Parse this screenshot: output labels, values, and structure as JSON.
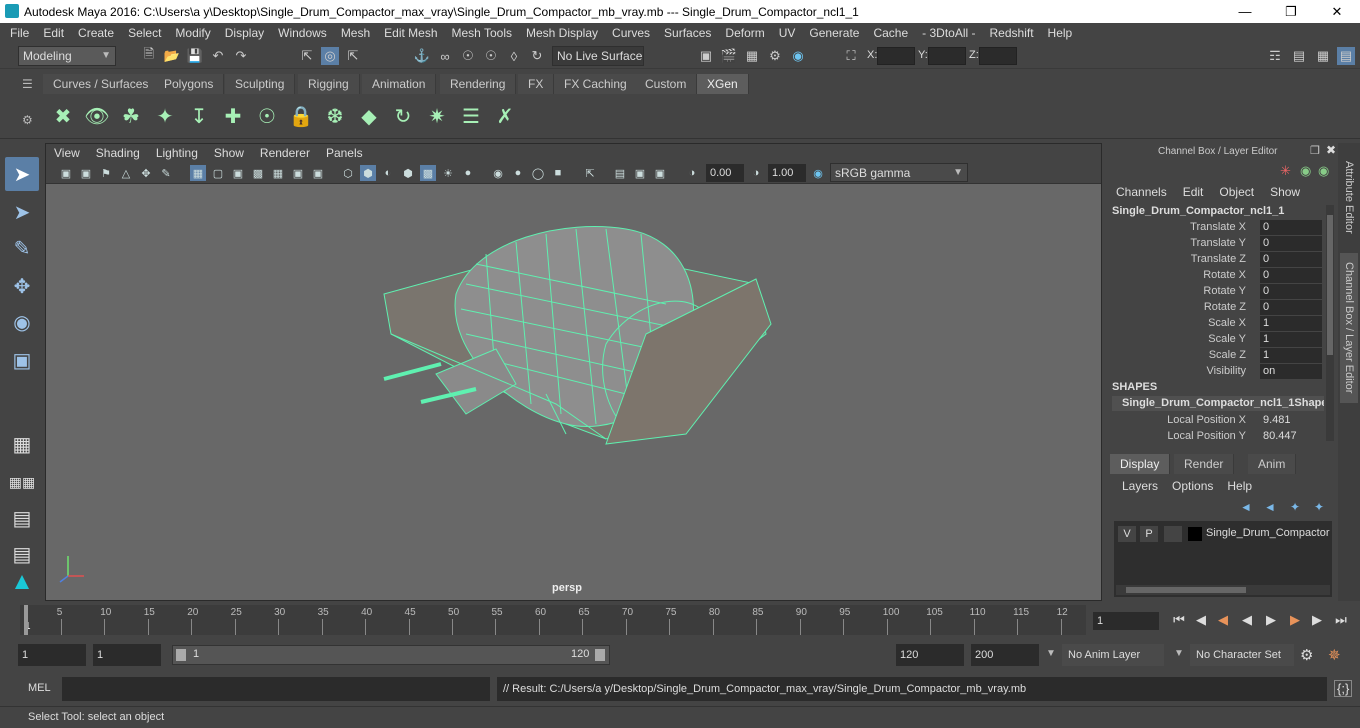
{
  "window": {
    "title": "Autodesk Maya 2016: C:\\Users\\a y\\Desktop\\Single_Drum_Compactor_max_vray\\Single_Drum_Compactor_mb_vray.mb   ---   Single_Drum_Compactor_ncl1_1"
  },
  "menu": [
    "File",
    "Edit",
    "Create",
    "Select",
    "Modify",
    "Display",
    "Windows",
    "Mesh",
    "Edit Mesh",
    "Mesh Tools",
    "Mesh Display",
    "Curves",
    "Surfaces",
    "Deform",
    "UV",
    "Generate",
    "Cache",
    "- 3DtoAll -",
    "Redshift",
    "Help"
  ],
  "status_line": {
    "mode": "Modeling",
    "live_surface": "No Live Surface",
    "x_label": "X:",
    "y_label": "Y:",
    "z_label": "Z:"
  },
  "shelf_tabs": [
    "Curves / Surfaces",
    "Polygons",
    "Sculpting",
    "Rigging",
    "Animation",
    "Rendering",
    "FX",
    "FX Caching",
    "Custom",
    "XGen"
  ],
  "active_shelf_tab": "XGen",
  "viewport": {
    "menu": [
      "View",
      "Shading",
      "Lighting",
      "Show",
      "Renderer",
      "Panels"
    ],
    "exposure": "0.00",
    "gamma": "1.00",
    "color_space": "sRGB gamma",
    "camera_label": "persp",
    "wire_color": "#5ff0b0"
  },
  "channel_box": {
    "title": "Channel Box / Layer Editor",
    "menu": [
      "Channels",
      "Edit",
      "Object",
      "Show"
    ],
    "object_name": "Single_Drum_Compactor_ncl1_1",
    "attributes": [
      {
        "label": "Translate X",
        "value": "0"
      },
      {
        "label": "Translate Y",
        "value": "0"
      },
      {
        "label": "Translate Z",
        "value": "0"
      },
      {
        "label": "Rotate X",
        "value": "0"
      },
      {
        "label": "Rotate Y",
        "value": "0"
      },
      {
        "label": "Rotate Z",
        "value": "0"
      },
      {
        "label": "Scale X",
        "value": "1"
      },
      {
        "label": "Scale Y",
        "value": "1"
      },
      {
        "label": "Scale Z",
        "value": "1"
      },
      {
        "label": "Visibility",
        "value": "on"
      }
    ],
    "shapes_header": "SHAPES",
    "shape_name": "Single_Drum_Compactor_ncl1_1Shape",
    "shape_attributes": [
      {
        "label": "Local Position X",
        "value": "9.481"
      },
      {
        "label": "Local Position Y",
        "value": "80.447"
      }
    ]
  },
  "layer_editor": {
    "tabs": [
      "Display",
      "Render",
      "Anim"
    ],
    "active_tab": "Display",
    "menu": [
      "Layers",
      "Options",
      "Help"
    ],
    "layer_v": "V",
    "layer_p": "P",
    "layer_name": "Single_Drum_Compactor"
  },
  "side_tabs": [
    "Attribute Editor",
    "Channel Box / Layer Editor"
  ],
  "time_slider": {
    "ticks": [
      "5",
      "10",
      "15",
      "20",
      "25",
      "30",
      "35",
      "40",
      "45",
      "50",
      "55",
      "60",
      "65",
      "70",
      "75",
      "80",
      "85",
      "90",
      "95",
      "100",
      "105",
      "110",
      "115",
      "12"
    ],
    "start_marker": "1",
    "current_frame": "1"
  },
  "range_bar": {
    "start": "1",
    "playback_start": "1",
    "range_start_label": "1",
    "range_end_label": "120",
    "playback_end": "120",
    "end": "200",
    "anim_layer": "No Anim Layer",
    "character_set": "No Character Set"
  },
  "command_line": {
    "lang": "MEL",
    "result": "// Result: C:/Users/a y/Desktop/Single_Drum_Compactor_max_vray/Single_Drum_Compactor_mb_vray.mb"
  },
  "help_line": "Select Tool: select an object"
}
